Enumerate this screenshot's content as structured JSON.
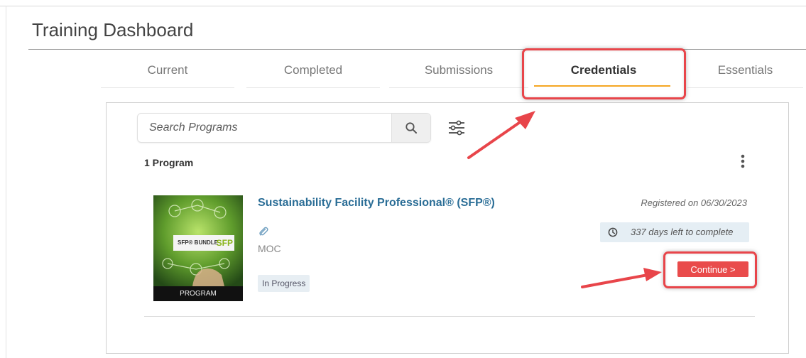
{
  "page": {
    "title": "Training Dashboard"
  },
  "tabs": [
    {
      "label": "Current",
      "active": false
    },
    {
      "label": "Completed",
      "active": false
    },
    {
      "label": "Submissions",
      "active": false
    },
    {
      "label": "Credentials",
      "active": true
    },
    {
      "label": "Essentials",
      "active": false
    }
  ],
  "search": {
    "placeholder": "Search Programs",
    "value": ""
  },
  "list": {
    "count_label": "1 Program"
  },
  "program": {
    "title": "Sustainability Facility Professional® (SFP®)",
    "provider": "MOC",
    "status": "In Progress",
    "thumbnail_bundle_text": "SFP® BUNDLE",
    "thumbnail_logo": "SFP",
    "thumbnail_caption": "PROGRAM",
    "registered": "Registered on 06/30/2023",
    "days_left": "337 days left to complete",
    "continue_label": "Continue >"
  },
  "icons": {
    "search": "search-icon",
    "filter": "sliders-icon",
    "more": "kebab-menu-icon",
    "attachment": "paperclip-icon",
    "clock": "clock-icon"
  },
  "colors": {
    "accent_tab": "#f5a623",
    "link": "#2a6d96",
    "continue": "#e94b4b",
    "annotation": "#e8454a"
  }
}
